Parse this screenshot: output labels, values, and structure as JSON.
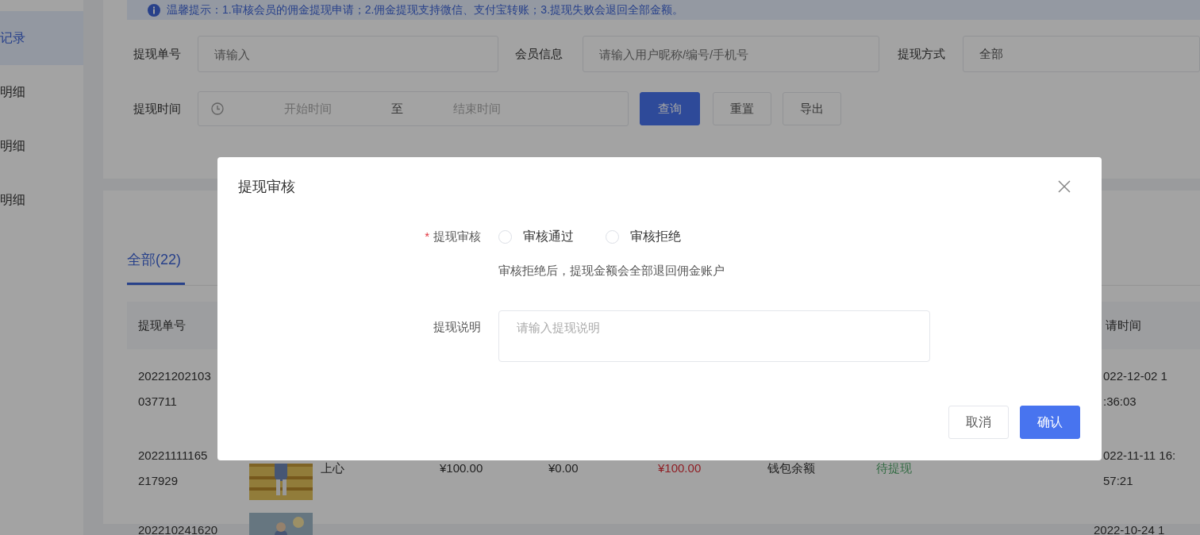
{
  "sidebar": {
    "items": [
      {
        "label": "记录",
        "selected": true
      },
      {
        "label": "明细",
        "selected": false
      },
      {
        "label": "明细",
        "selected": false
      },
      {
        "label": "明细",
        "selected": false
      }
    ]
  },
  "notice": {
    "text": "温馨提示：1.审核会员的佣金提现申请；2.佣金提现支持微信、支付宝转账；3.提现失败会退回全部金额。"
  },
  "filters": {
    "order_no": {
      "label": "提现单号",
      "placeholder": "请输入"
    },
    "member": {
      "label": "会员信息",
      "placeholder": "请输入用户昵称/编号/手机号"
    },
    "method": {
      "label": "提现方式",
      "value": "全部"
    },
    "time": {
      "label": "提现时间",
      "start_placeholder": "开始时间",
      "separator": "至",
      "end_placeholder": "结束时间"
    },
    "buttons": [
      {
        "label": "查询",
        "kind": "primary"
      },
      {
        "label": "重置",
        "kind": "default"
      },
      {
        "label": "导出",
        "kind": "default"
      }
    ]
  },
  "tabs": [
    {
      "label": "全部(22)",
      "selected": true
    }
  ],
  "table": {
    "columns": [
      {
        "label": "提现单号"
      },
      {
        "label": "请时间"
      }
    ],
    "rows": [
      {
        "order_no": [
          "20221202103",
          "037711"
        ],
        "time": [
          "022-12-02 1",
          ":36:03"
        ]
      },
      {
        "order_no": [
          "20221111165",
          "217929"
        ],
        "picture": true,
        "member": "上心",
        "amount": "¥100.00",
        "fee": "¥0.00",
        "actual": "¥100.00",
        "method": "钱包余额",
        "status": "待提现",
        "time": [
          "022-11-11 16:",
          "57:21"
        ]
      },
      {
        "order_no": [
          "202210241620"
        ],
        "picture": true,
        "time": [
          "2022-10-24 1"
        ]
      }
    ]
  },
  "dialog": {
    "title": "提现审核",
    "fields": [
      {
        "kind": "radio",
        "required_mark": "*",
        "label": "提现审核",
        "options": [
          {
            "label": "审核通过",
            "selected": false
          },
          {
            "label": "审核拒绝",
            "selected": false
          }
        ],
        "hint": "审核拒绝后，提现金额会全部退回佣金账户"
      },
      {
        "kind": "textarea",
        "label": "提现说明",
        "placeholder": "请输入提现说明"
      }
    ],
    "buttons": [
      {
        "label": "取消",
        "kind": "default"
      },
      {
        "label": "确认",
        "kind": "primary"
      }
    ]
  }
}
